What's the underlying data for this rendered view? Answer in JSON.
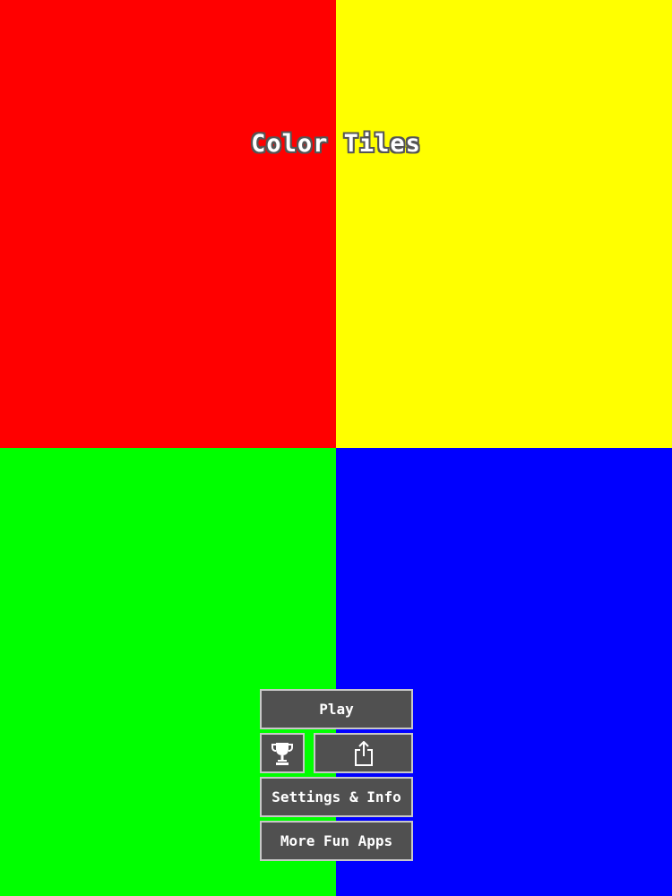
{
  "game": {
    "title": "Color Tiles"
  },
  "tiles": [
    {
      "name": "red",
      "color": "#ff0000"
    },
    {
      "name": "yellow",
      "color": "#ffff00"
    },
    {
      "name": "green",
      "color": "#00ff00"
    },
    {
      "name": "blue",
      "color": "#0000ff"
    }
  ],
  "menu": {
    "play_label": "Play",
    "leaderboard_icon": "trophy-icon",
    "share_icon": "share-icon",
    "settings_label": "Settings & Info",
    "more_apps_label": "More Fun Apps"
  },
  "colors": {
    "button_bg": "#505050",
    "button_border": "#c8c8c8",
    "button_text": "#ffffff"
  }
}
